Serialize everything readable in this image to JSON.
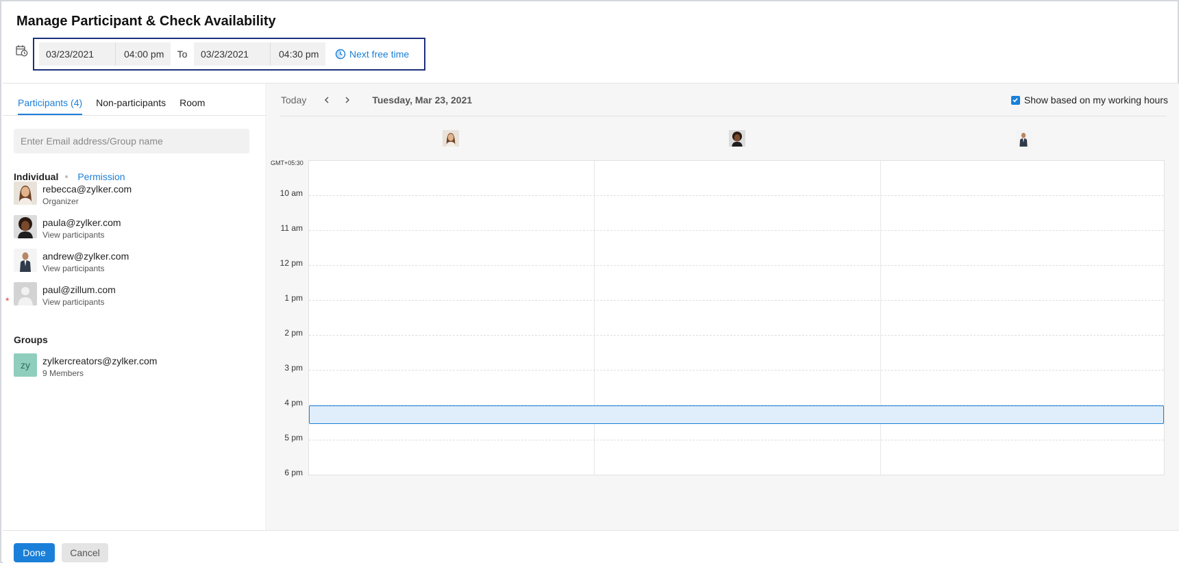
{
  "header": {
    "title": "Manage Participant & Check Availability",
    "start_date": "03/23/2021",
    "start_time": "04:00 pm",
    "to_label": "To",
    "end_date": "03/23/2021",
    "end_time": "04:30 pm",
    "next_free_label": "Next free time",
    "accent_color": "#1a7fd8",
    "range_border_color": "#1b2f7a"
  },
  "left": {
    "tabs": [
      {
        "label": "Participants (4)",
        "active": true
      },
      {
        "label": "Non-participants",
        "active": false
      },
      {
        "label": "Room",
        "active": false
      }
    ],
    "search_placeholder": "Enter Email address/Group name",
    "individual_label": "Individual",
    "permission_label": "Permission",
    "participants": [
      {
        "email": "rebecca@zylker.com",
        "sub": "Organizer",
        "avatar": "woman-light-photo"
      },
      {
        "email": "paula@zylker.com",
        "sub": "View participants",
        "avatar": "woman-dark-photo"
      },
      {
        "email": "andrew@zylker.com",
        "sub": "View participants",
        "avatar": "man-suit-photo"
      },
      {
        "email": "paul@zillum.com",
        "sub": "View participants",
        "avatar": "default-user-icon",
        "required": "*"
      }
    ],
    "groups_label": "Groups",
    "groups": [
      {
        "initials": "zy",
        "email": "zylkercreators@zylker.com",
        "sub": "9 Members"
      }
    ]
  },
  "calendar": {
    "today_label": "Today",
    "prev_icon": "chevron-left-icon",
    "next_icon": "chevron-right-icon",
    "date_label": "Tuesday, Mar 23, 2021",
    "working_hours_label": "Show based on my working hours",
    "working_hours_checked": true,
    "timezone": "GMT+05:30",
    "hours": [
      "10 am",
      "11 am",
      "12 pm",
      "1 pm",
      "2 pm",
      "3 pm",
      "4 pm",
      "5 pm",
      "6 pm"
    ],
    "event_start": "4 pm",
    "event_end": "4:30 pm",
    "event_color": "#dfeefa"
  },
  "footer": {
    "done_label": "Done",
    "cancel_label": "Cancel"
  }
}
